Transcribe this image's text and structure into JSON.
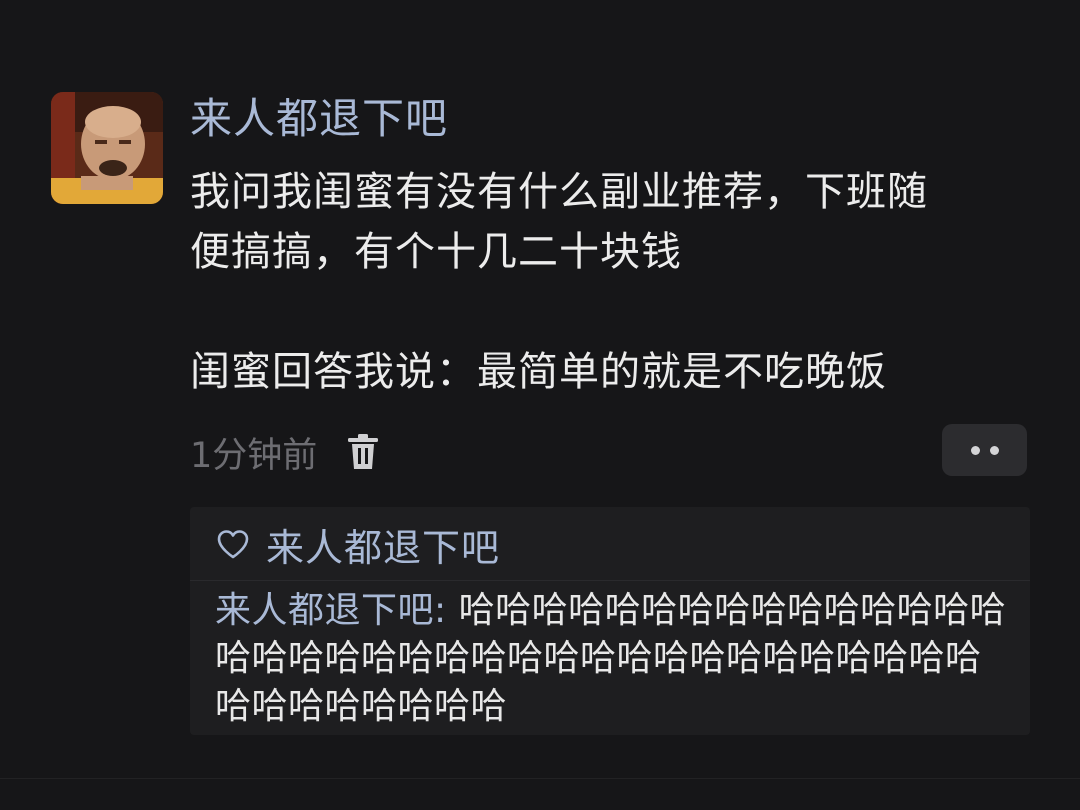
{
  "post": {
    "username": "来人都退下吧",
    "body_lines": [
      "我问我闺蜜有没有什么副业推荐，下班随",
      "便搞搞，有个十几二十块钱",
      "闺蜜回答我说：最简单的就是不吃晚饭"
    ],
    "timestamp": "1分钟前",
    "delete_icon": "trash-icon",
    "more_icon": "more-dots-icon"
  },
  "reply_section": {
    "like_icon": "heart-icon",
    "liker": "来人都退下吧",
    "reply": {
      "author": "来人都退下吧",
      "separator": ": ",
      "text": "哈哈哈哈哈哈哈哈哈哈哈哈哈哈哈哈哈哈哈哈哈哈哈哈哈哈哈哈哈哈哈哈哈哈哈哈哈哈哈哈哈哈哈哈"
    }
  },
  "colors": {
    "background": "#161618",
    "username": "#a9b9d6",
    "body_text": "#ececec",
    "timestamp": "#6d6d72",
    "reply_box": "#1e1e20"
  }
}
